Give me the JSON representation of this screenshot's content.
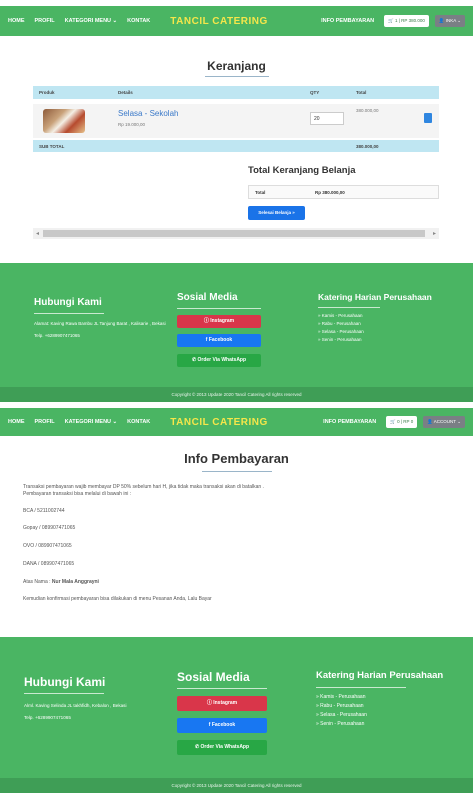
{
  "nav": {
    "home": "HOME",
    "profil": "PROFIL",
    "kategori": "KATEGORI MENU ⌄",
    "kontak": "KONTAK",
    "brand": "TANCIL CATERING",
    "info": "INFO PEMBAYARAN",
    "cart1": "🛒 1 | RP 380.000",
    "account1": "👤 INKA ⌄",
    "cart2": "🛒 0 | RP 0",
    "account2": "👤 ACCOUNT ⌄"
  },
  "cart": {
    "title": "Keranjang",
    "headers": [
      "Produk",
      "Details",
      "QTY",
      "Total"
    ],
    "item": {
      "name": "Selasa - Sekolah",
      "price": "Rp 19.000,00",
      "qty": "20",
      "total": "380.000,00"
    },
    "subtotal_label": "SUB TOTAL",
    "subtotal_value": "380.000,00"
  },
  "summary": {
    "title": "Total Keranjang Belanja",
    "label": "Total",
    "value": "Rp 380.000,00",
    "button": "Selesai Belanja »"
  },
  "footer": {
    "contact_title": "Hubungi Kami",
    "address": "Alamat: Kaving Rawa Bambu JL Tanjung Barat , Kalisarie , Bekasi",
    "address_short": "Alml. Kaving Selinda JL takhfidh, Kebalon , Bekasi",
    "phone": "Telp. +6289907471065",
    "social_title": "Sosial Media",
    "instagram": "Ⓘ Instagram",
    "facebook": "f Facebook",
    "whatsapp": "✆ Order Via WhatsApp",
    "catering_title": "Katering Harian Perusahaan",
    "days": [
      "» Kamis - Perusahaan",
      "» Rabu - Perusahaan",
      "» Selasa - Perusahaan",
      "» Senin - Perusahaan"
    ],
    "copyright": "Copyright © 2013 Update 2020 Tancil Catering All rights reserved"
  },
  "info": {
    "title": "Info Pembayaran",
    "line1": "Transaksi pembayaran wajib membayar DP 50% sebelum hari H, jika tidak maka transaksi akan di batalkan .",
    "line2": "Pembayaran transaksi bisa melalui di bawah ini :",
    "bca": "BCA / 5211002744",
    "gopay": "Gopay / 089907471065",
    "ovo": "OVO / 089907471065",
    "dana": "DANA / 089907471065",
    "atas_label": "Atas Nama : ",
    "atas_name": "Nur Mala Anggrayni",
    "confirm": "Kemudian konfirmasi pembayaran bisa dilakukan di menu Pesanan Anda, Lalu Bayar"
  },
  "colors": {
    "nav_green": "#4ab563",
    "brand_yellow": "#f5e64a",
    "table_blue": "#bfe6f2",
    "button_blue": "#1a73e8",
    "instagram_red": "#d9364a",
    "facebook_blue": "#1877f2",
    "whatsapp_green": "#28a745"
  }
}
